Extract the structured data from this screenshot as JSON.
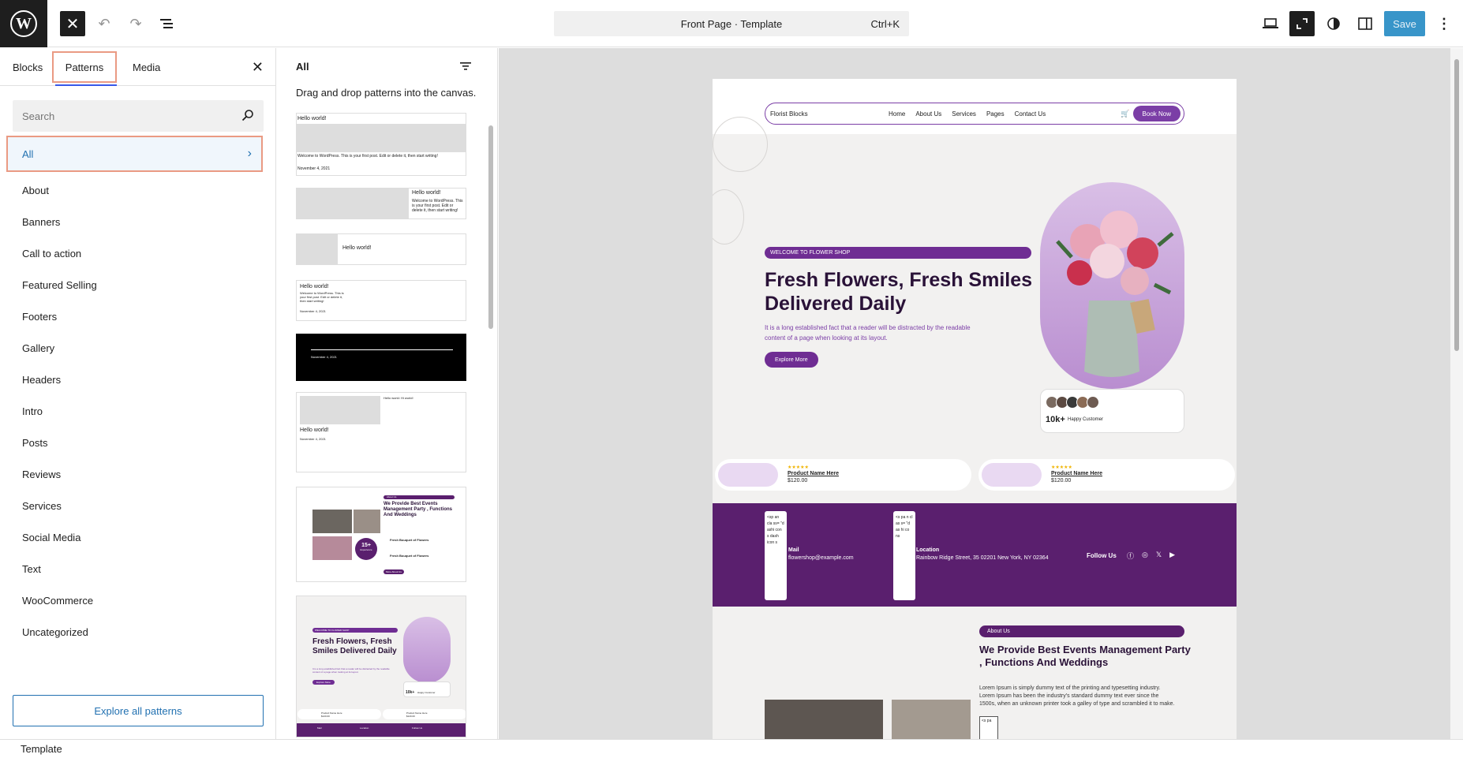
{
  "topbar": {
    "command_label": "Front Page · Template",
    "shortcut": "Ctrl+K",
    "save_label": "Save"
  },
  "inserter": {
    "tabs": [
      "Blocks",
      "Patterns",
      "Media"
    ],
    "search_placeholder": "Search",
    "active_category": "All",
    "categories": [
      "About",
      "Banners",
      "Call to action",
      "Featured Selling",
      "Footers",
      "Gallery",
      "Headers",
      "Intro",
      "Posts",
      "Reviews",
      "Services",
      "Social Media",
      "Text",
      "WooCommerce",
      "Uncategorized"
    ],
    "explore_label": "Explore all patterns"
  },
  "patterns": {
    "title": "All",
    "description": "Drag and drop patterns into the canvas.",
    "p1_title": "Hello world!",
    "p1_text": "Welcome to WordPress. This is your first post. Edit or delete it, then start writing!",
    "p1_date": "November 4, 2021",
    "p2_title": "Hello world!",
    "p2_text": "Welcome to WordPress. This is your first post. Edit or delete it, then start writing!",
    "p3_title": "Hello world!",
    "p4_title": "Hello world!",
    "p4_text": "Welcome to WordPress. This is your first post. Edit or delete it, then start writing!",
    "p4_date": "November 4, 2021",
    "p5_date": "November 4, 2021",
    "p6_small": "Hello world: Hi world!",
    "p6_title": "Hello world!",
    "p6_date": "November 4, 2021",
    "p7_badge": "About Us",
    "p7_title": "We Provide Best Events Management Party , Functions And Weddings",
    "p7_stat": "15+",
    "p7_stat_label": "Experience",
    "p7_item1": "Fresh Bouquet of Flowers",
    "p7_item2": "Fresh Bouquet of Flowers",
    "p7_btn": "More About Us",
    "p8_badge": "WELCOME TO FLOWER SHOP",
    "p8_title": "Fresh Flowers, Fresh Smiles Delivered Daily",
    "p8_desc": "It is a long established fact that a reader will be distracted by the readable content of a page when looking at its layout.",
    "p8_btn": "Explore More",
    "p8_count": "10k+",
    "p8_count_label": "Happy Customer",
    "p8_prod1": "Product Name Here",
    "p8_price1": "$120.00",
    "p8_prod2": "Product Name Here",
    "p8_price2": "$120.00",
    "p8_band_mail": "Mail",
    "p8_band_loc": "Location",
    "p8_band_follow": "Follow Us"
  },
  "canvas": {
    "nav": {
      "brand": "Florist Blocks",
      "links": [
        "Home",
        "About Us",
        "Services",
        "Pages",
        "Contact Us"
      ],
      "book": "Book Now"
    },
    "hero": {
      "badge": "WELCOME TO FLOWER SHOP",
      "title": "Fresh Flowers, Fresh Smiles Delivered Daily",
      "desc": "It is a long established fact that a reader will be distracted by the readable content of a page when looking at its layout.",
      "button": "Explore More",
      "count": "10k+",
      "count_label": "Happy Customer"
    },
    "products": [
      {
        "stars": "★★★★★",
        "name": "Product Name Here",
        "price": "$120.00"
      },
      {
        "stars": "★★★★★",
        "name": "Product Name Here",
        "price": "$120.00"
      }
    ],
    "contact": {
      "mail_title": "Mail",
      "mail_value": "flowershop@example.com",
      "loc_title": "Location",
      "loc_value": "Rainbow Ridge Street, 35 02201 New York, NY 02364",
      "follow": "Follow Us",
      "scroll1": "<sp an cla ss= \"d ashi con s dash icon s",
      "scroll2": "<s pa n cl as s= \"d as hi co ns"
    },
    "about": {
      "badge": "About Us",
      "title": "We Provide Best Events Management Party , Functions And Weddings",
      "desc": "Lorem Ipsum is simply dummy text of the printing and typesetting industry. Lorem Ipsum has been the industry's standard dummy text ever since the 1500s, when an unknown printer took a galley of type and scrambled it to make.",
      "snippet": "<s pa"
    }
  },
  "statusbar": {
    "label": "Template"
  }
}
